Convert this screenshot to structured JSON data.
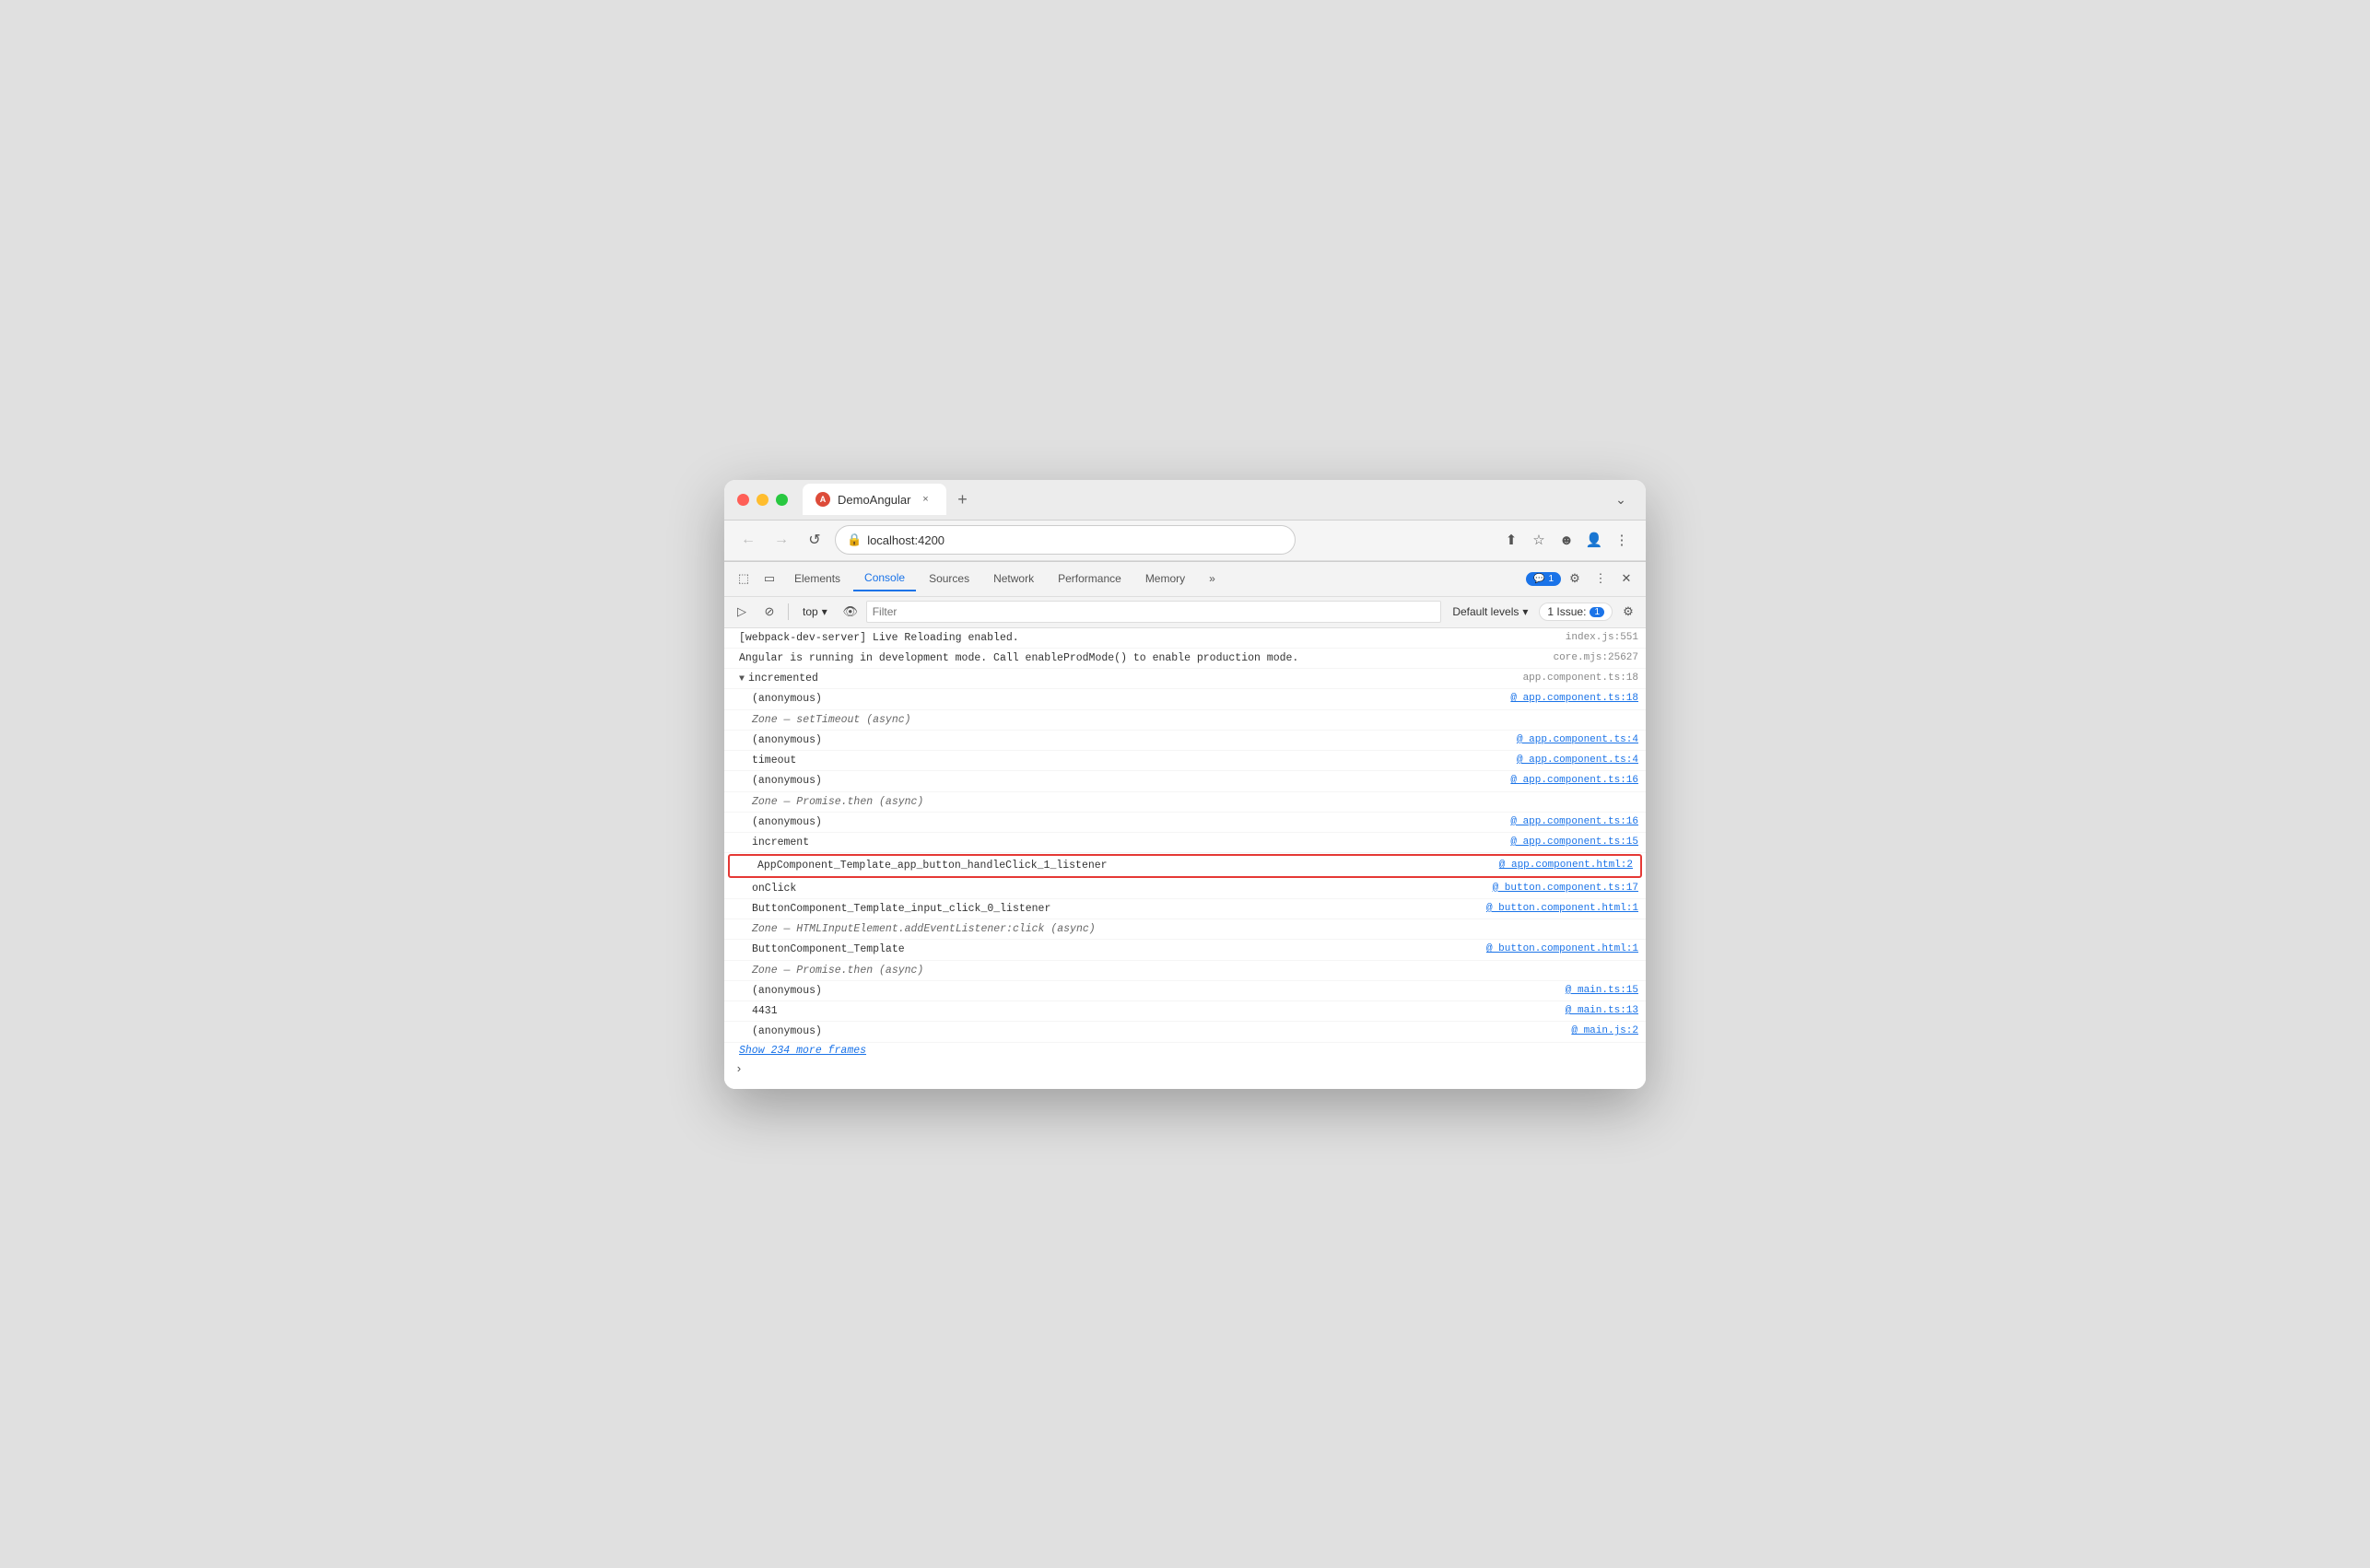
{
  "browser": {
    "tab_title": "DemoAngular",
    "tab_close": "×",
    "tab_new": "+",
    "url": "localhost:4200",
    "title_bar_end": [
      "chevron-down"
    ]
  },
  "nav": {
    "back": "←",
    "forward": "→",
    "refresh": "↺",
    "url_icon": "🔒"
  },
  "devtools": {
    "tabs": [
      {
        "label": "Elements",
        "active": false
      },
      {
        "label": "Console",
        "active": true
      },
      {
        "label": "Sources",
        "active": false
      },
      {
        "label": "Network",
        "active": false
      },
      {
        "label": "Performance",
        "active": false
      },
      {
        "label": "Memory",
        "active": false
      }
    ],
    "notification_label": "1",
    "more_tabs": "»",
    "issue_label": "1 Issue:",
    "issue_count": "1"
  },
  "console_toolbar": {
    "context": "top",
    "filter_placeholder": "Filter",
    "default_levels": "Default levels",
    "issue_label": "1 Issue:",
    "issue_count": "1"
  },
  "console_lines": [
    {
      "id": 1,
      "indent": 0,
      "content": "[webpack-dev-server] Live Reloading enabled.",
      "source": "index.js:551",
      "source_type": "gray"
    },
    {
      "id": 2,
      "indent": 0,
      "content": "Angular is running in development mode. Call enableProdMode() to enable production mode.",
      "source": "core.mjs:25627",
      "source_type": "gray"
    },
    {
      "id": 3,
      "indent": 0,
      "triangle": "▼",
      "content": "incremented",
      "source": "app.component.ts:18",
      "source_type": "gray"
    },
    {
      "id": 4,
      "indent": 1,
      "content": "(anonymous)",
      "at": "@ ",
      "source": "app.component.ts:18",
      "source_type": "link"
    },
    {
      "id": 5,
      "indent": 1,
      "content": "Zone — setTimeout (async)",
      "source": "",
      "source_type": "none"
    },
    {
      "id": 6,
      "indent": 1,
      "content": "(anonymous)",
      "at": "@ ",
      "source": "app.component.ts:4",
      "source_type": "link"
    },
    {
      "id": 7,
      "indent": 1,
      "content": "timeout",
      "at": "@ ",
      "source": "app.component.ts:4",
      "source_type": "link"
    },
    {
      "id": 8,
      "indent": 1,
      "content": "(anonymous)",
      "at": "@ ",
      "source": "app.component.ts:16",
      "source_type": "link"
    },
    {
      "id": 9,
      "indent": 1,
      "content": "Zone — Promise.then (async)",
      "source": "",
      "source_type": "none"
    },
    {
      "id": 10,
      "indent": 1,
      "content": "(anonymous)",
      "at": "@ ",
      "source": "app.component.ts:16",
      "source_type": "link"
    },
    {
      "id": 11,
      "indent": 1,
      "content": "increment",
      "at": "@ ",
      "source": "app.component.ts:15",
      "source_type": "link"
    },
    {
      "id": 12,
      "indent": 1,
      "content": "AppComponent_Template_app_button_handleClick_1_listener",
      "at": "@ ",
      "source": "app.component.html:2",
      "source_type": "link",
      "highlighted": true
    },
    {
      "id": 13,
      "indent": 1,
      "content": "onClick",
      "at": "@ ",
      "source": "button.component.ts:17",
      "source_type": "link"
    },
    {
      "id": 14,
      "indent": 1,
      "content": "ButtonComponent_Template_input_click_0_listener",
      "at": "@ ",
      "source": "button.component.html:1",
      "source_type": "link"
    },
    {
      "id": 15,
      "indent": 1,
      "content": "Zone — HTMLInputElement.addEventListener:click (async)",
      "source": "",
      "source_type": "none"
    },
    {
      "id": 16,
      "indent": 1,
      "content": "ButtonComponent_Template",
      "at": "@ ",
      "source": "button.component.html:1",
      "source_type": "link"
    },
    {
      "id": 17,
      "indent": 1,
      "content": "Zone — Promise.then (async)",
      "source": "",
      "source_type": "none"
    },
    {
      "id": 18,
      "indent": 1,
      "content": "(anonymous)",
      "at": "@ ",
      "source": "main.ts:15",
      "source_type": "link"
    },
    {
      "id": 19,
      "indent": 1,
      "content": "4431",
      "at": "@ ",
      "source": "main.ts:13",
      "source_type": "link"
    },
    {
      "id": 20,
      "indent": 1,
      "content": "(anonymous)",
      "at": "@ ",
      "source": "main.js:2",
      "source_type": "link"
    }
  ],
  "show_more": "Show 234 more frames",
  "colors": {
    "accent": "#1a73e8",
    "highlight_border": "#e53935"
  }
}
